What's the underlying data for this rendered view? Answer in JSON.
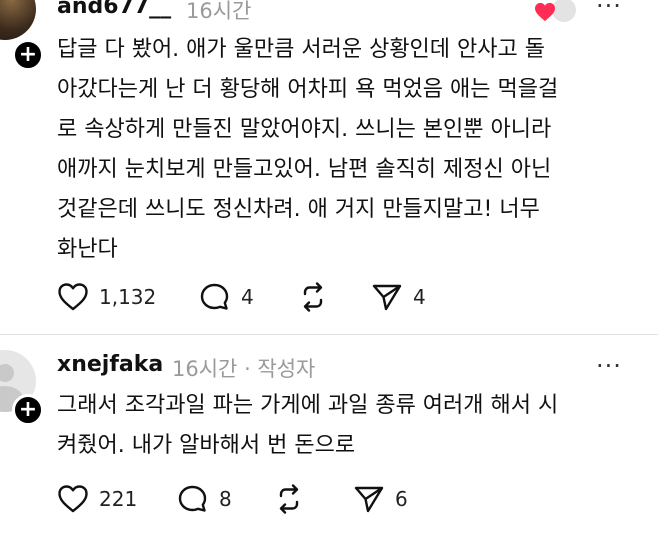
{
  "post1": {
    "username": "and677__",
    "time": "16시간",
    "avatar_icon": "profile-photo",
    "body_lines": [
      "답글 다 봤어. 애가 울만큼 서러운 상황인데 안사고 돌",
      "아갔다는게 난 더 황당해 어차피 욕 먹었음 애는 먹을걸",
      "로 속상하게 만들진 말았어야지. 쓰니는 본인뿐 아니라",
      "애까지 눈치보게 만들고있어. 남편 솔직히 제정신 아닌",
      "것같은데 쓰니도 정신차려. 애 거지 만들지말고! 너무",
      "화난다"
    ],
    "likes": "1,132",
    "comments": "4",
    "reposts": "",
    "shares": "4",
    "more_label": "···"
  },
  "post2": {
    "username": "xnejfaka",
    "time": "16시간",
    "author_tag": "· 작성자",
    "body_lines": [
      "그래서 조각과일 파는 가게에 과일 종류 여러개 해서 시",
      "켜줬어. 내가 알바해서 번 돈으로"
    ],
    "likes": "221",
    "comments": "8",
    "reposts": "",
    "shares": "6",
    "more_label": "···"
  },
  "colors": {
    "heart_red": "#ff2d55",
    "meta_gray": "#9a9a9a",
    "text": "#111111"
  }
}
